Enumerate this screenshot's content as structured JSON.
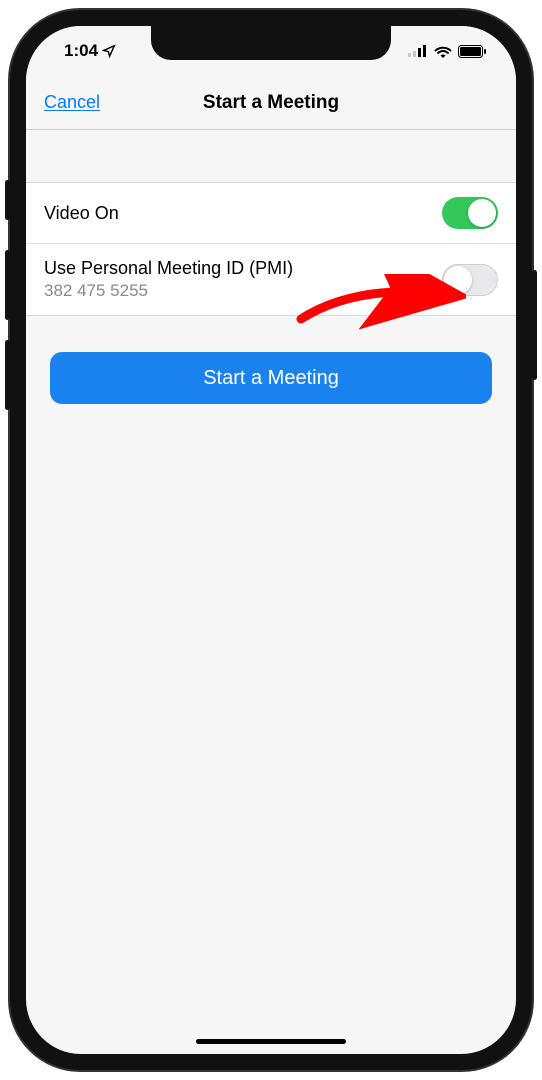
{
  "status": {
    "time": "1:04"
  },
  "nav": {
    "cancel": "Cancel",
    "title": "Start a Meeting"
  },
  "settings": {
    "video_on": {
      "label": "Video On",
      "value": true
    },
    "pmi": {
      "label": "Use Personal Meeting ID (PMI)",
      "id": "382 475 5255",
      "value": false
    }
  },
  "action": {
    "start": "Start a Meeting"
  },
  "colors": {
    "accent_blue": "#007aff",
    "button_blue": "#1a82ef",
    "toggle_green": "#34c759",
    "arrow_red": "#ff0000"
  }
}
